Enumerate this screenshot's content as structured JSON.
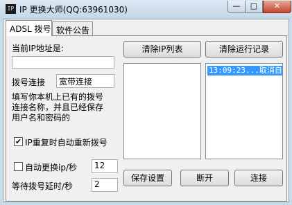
{
  "window": {
    "title": "IP 更换大师(QQ:63961030)",
    "icon_text": "IP",
    "minimize_glyph": "—",
    "maximize_glyph": "□",
    "close_glyph": "✕"
  },
  "tabs": [
    {
      "label": "ADSL 拨号",
      "active": true
    },
    {
      "label": "软件公告",
      "active": false
    }
  ],
  "left": {
    "current_ip_label": "当前IP地址是:",
    "current_ip_value": "",
    "dial_conn_label": "拨号连接",
    "dial_conn_value": "宽带连接",
    "hint": [
      "填写你本机上已有的拨号",
      "连接名称，并且已经保存",
      "用户名和密码的"
    ],
    "redial_checkbox": {
      "label": "IP重复时自动重新拨号",
      "checked": true
    },
    "auto_change": {
      "label": "自动更换ip/秒",
      "checked": false,
      "value": "12"
    },
    "wait_delay": {
      "label": "等待拨号延时/秒",
      "value": "2"
    }
  },
  "buttons": {
    "clear_ip_list": "清除IP列表",
    "clear_log": "清除运行记录",
    "save_settings": "保存设置",
    "disconnect": "断开",
    "connect": "连接"
  },
  "log": [
    "13:09:23...取消自"
  ]
}
